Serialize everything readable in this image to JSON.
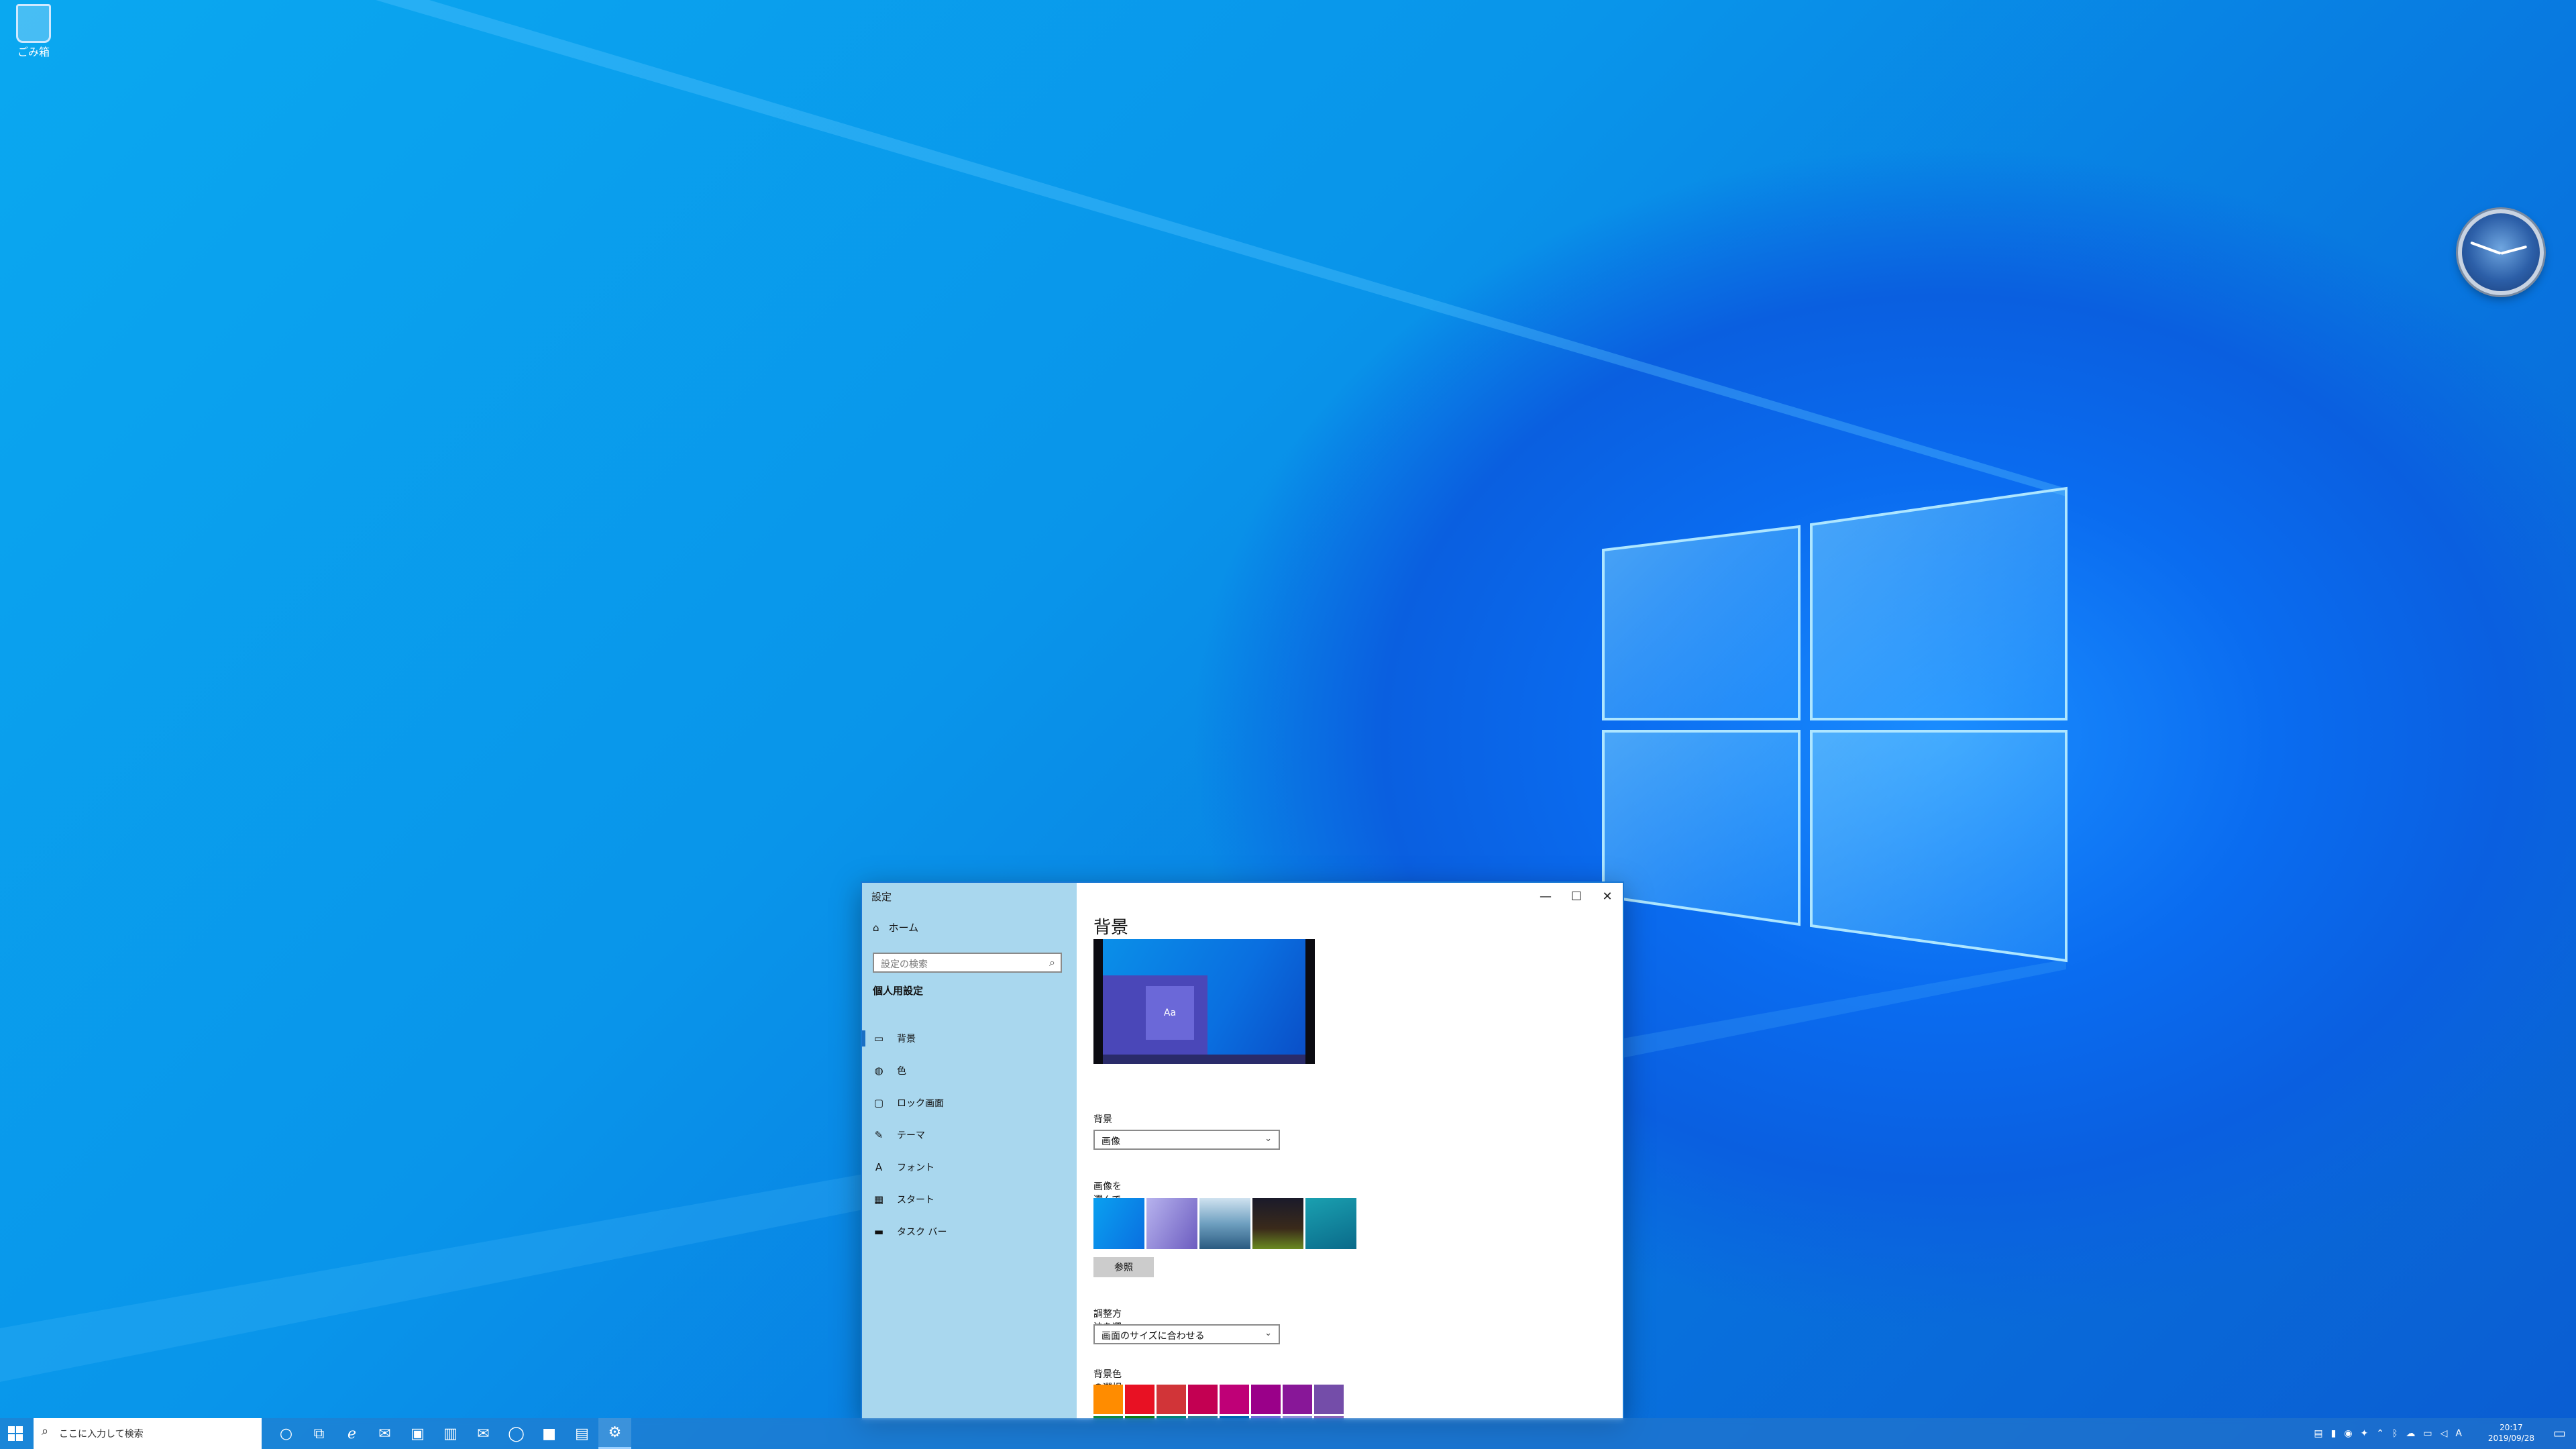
{
  "desktop": {
    "recycle_label": "ごみ箱"
  },
  "settings": {
    "title": "設定",
    "controls": {
      "minimize": "—",
      "maximize": "☐",
      "close": "✕"
    },
    "home_label": "ホーム",
    "search_placeholder": "設定の検索",
    "section_title": "個人用設定",
    "nav": [
      {
        "label": "背景",
        "icon": "picture-icon"
      },
      {
        "label": "色",
        "icon": "palette-icon"
      },
      {
        "label": "ロック画面",
        "icon": "lock-screen-icon"
      },
      {
        "label": "テーマ",
        "icon": "theme-icon"
      },
      {
        "label": "フォント",
        "icon": "font-icon"
      },
      {
        "label": "スタート",
        "icon": "start-icon"
      },
      {
        "label": "タスク バー",
        "icon": "taskbar-icon"
      }
    ],
    "page_title": "背景",
    "preview_tile": "Aa",
    "bg_label": "背景",
    "bg_value": "画像",
    "choose_label": "画像を選んでください",
    "browse_label": "参照",
    "fit_label": "調整方法を選ぶ",
    "fit_value": "画面のサイズに合わせる",
    "color_label": "背景色の選択",
    "swatch_colors": [
      "#ff8c00",
      "#e81123",
      "#d13438",
      "#c30052",
      "#bf0077",
      "#9a0089",
      "#881798",
      "#744da9",
      "#10893e",
      "#107c10",
      "#018574",
      "#2d7d9a",
      "#0063b1",
      "#6b69d6",
      "#8e8cd8",
      "#8764b8"
    ]
  },
  "taskbar": {
    "search_placeholder": "ここに入力して検索",
    "time": "20:17",
    "date": "2019/09/28"
  }
}
